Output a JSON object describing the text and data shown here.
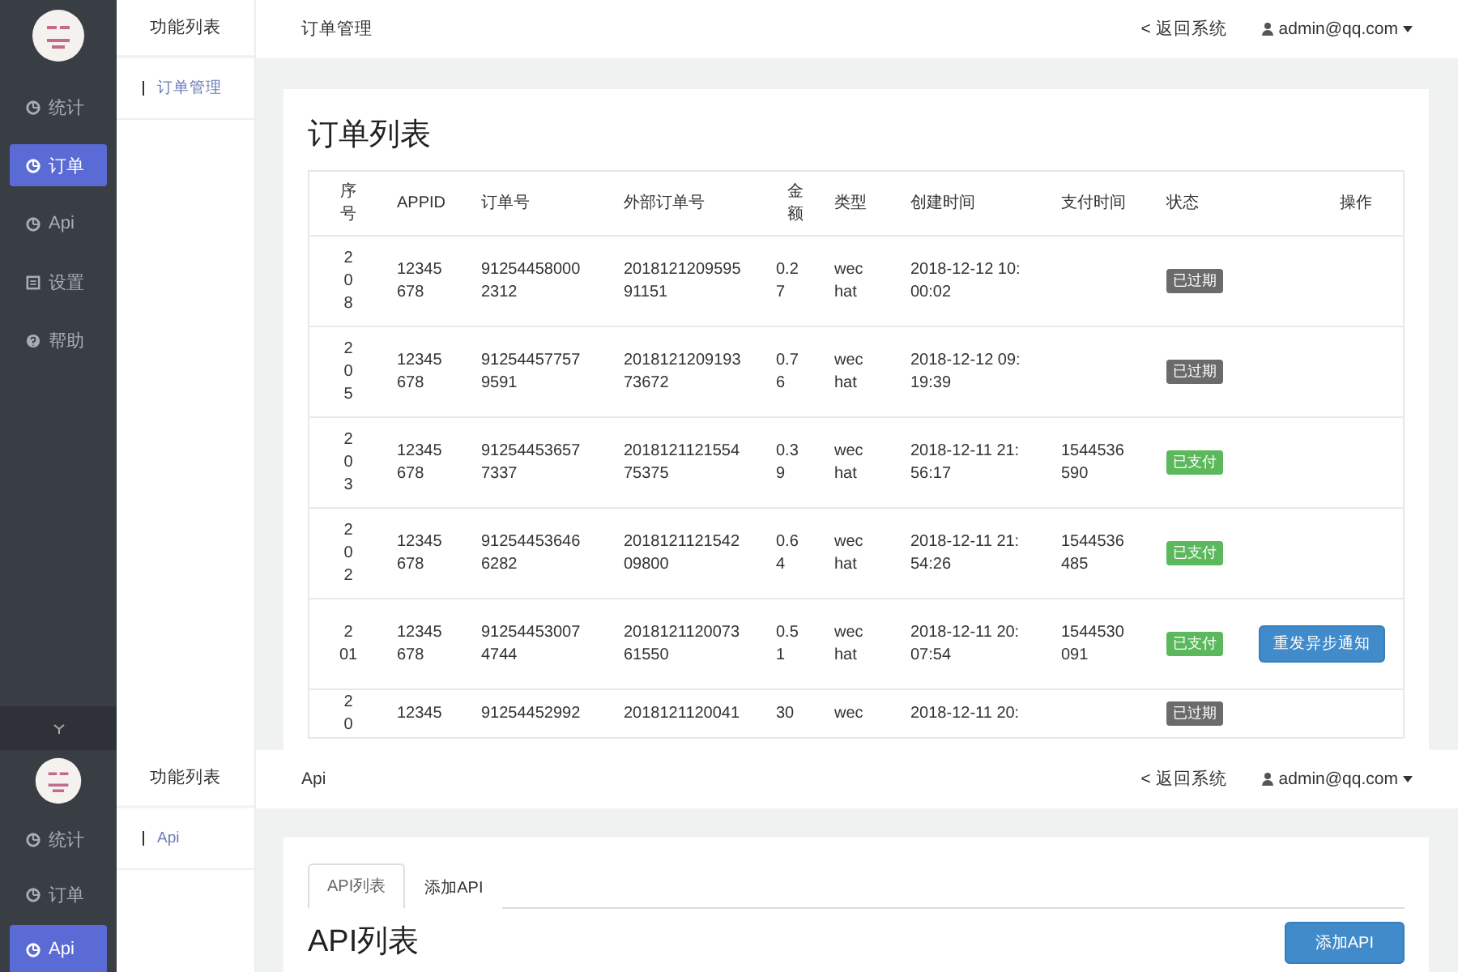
{
  "screens": [
    {
      "sidebar": {
        "items": [
          {
            "label": "统计",
            "kind": "chart",
            "selected": false
          },
          {
            "label": "订单",
            "kind": "chart",
            "selected": true
          },
          {
            "label": "Api",
            "kind": "chart",
            "selected": false
          },
          {
            "label": "设置",
            "kind": "list",
            "selected": false
          },
          {
            "label": "帮助",
            "kind": "help",
            "selected": false
          }
        ],
        "collapsed": false
      },
      "submenu": {
        "title": "功能列表",
        "items": [
          {
            "label": "订单管理",
            "selected": true
          }
        ]
      },
      "header": {
        "breadcrumb": "订单管理",
        "back_link": "< 返回系统",
        "user": "admin@qq.com"
      },
      "kind": "orders",
      "title": "订单列表",
      "table": {
        "columns": [
          "序号",
          "APPID",
          "订单号",
          "外部订单号",
          "金额",
          "类型",
          "创建时间",
          "支付时间",
          "状态",
          "操作"
        ],
        "rows": [
          {
            "seq": "2\n0\n8",
            "appid": "12345\n678",
            "order_no": "91254458000\n2312",
            "ext_order_no": "2018121209595\n91151",
            "amount": "0.2\n7",
            "type": "wec\nhat",
            "created": "2018-12-12 10:\n00:02",
            "status": {
              "label": "已过期",
              "color": "#6b6b6b"
            }
          },
          {
            "seq": "2\n0\n5",
            "appid": "12345\n678",
            "order_no": "91254457757\n9591",
            "ext_order_no": "2018121209193\n73672",
            "amount": "0.7\n6",
            "type": "wec\nhat",
            "created": "2018-12-12 09:\n19:39",
            "status": {
              "label": "已过期",
              "color": "#6b6b6b"
            }
          },
          {
            "seq": "2\n0\n3",
            "appid": "12345\n678",
            "order_no": "91254453657\n7337",
            "ext_order_no": "2018121121554\n75375",
            "amount": "0.3\n9",
            "type": "wec\nhat",
            "created": "2018-12-11 21:\n56:17",
            "paid": "1544536\n590",
            "status": {
              "label": "已支付",
              "color": "#5cb85c"
            }
          },
          {
            "seq": "2\n0\n2",
            "appid": "12345\n678",
            "order_no": "91254453646\n6282",
            "ext_order_no": "2018121121542\n09800",
            "amount": "0.6\n4",
            "type": "wec\nhat",
            "created": "2018-12-11 21:\n54:26",
            "paid": "1544536\n485",
            "status": {
              "label": "已支付",
              "color": "#5cb85c"
            }
          },
          {
            "seq": "2\n01",
            "appid": "12345\n678",
            "order_no": "91254453007\n4744",
            "ext_order_no": "2018121120073\n61550",
            "amount": "0.5\n1",
            "type": "wec\nhat",
            "created": "2018-12-11 20:\n07:54",
            "paid": "1544530\n091",
            "status": {
              "label": "已支付",
              "color": "#5cb85c"
            },
            "action": "重发异步通知"
          },
          {
            "seq": "2\n0",
            "appid": "12345",
            "order_no": "91254452992",
            "ext_order_no": "2018121120041",
            "amount": "30",
            "type": "wec",
            "created": "2018-12-11 20:",
            "status": {
              "label": "已过期",
              "color": "#6b6b6b"
            }
          }
        ]
      }
    },
    {
      "sidebar": {
        "items": [
          {
            "label": "统计",
            "kind": "chart",
            "selected": false
          },
          {
            "label": "订单",
            "kind": "chart",
            "selected": false
          },
          {
            "label": "Api",
            "kind": "chart",
            "selected": true
          }
        ]
      },
      "submenu": {
        "title": "功能列表",
        "items": [
          {
            "label": "Api",
            "selected": true
          }
        ]
      },
      "header": {
        "breadcrumb": "Api",
        "back_link": "< 返回系统",
        "user": "admin@qq.com"
      },
      "kind": "api",
      "tabs": [
        {
          "label": "API列表",
          "selected": true
        },
        {
          "label": "添加API",
          "selected": false
        }
      ],
      "title": "API列表",
      "add_button": "添加API"
    }
  ]
}
